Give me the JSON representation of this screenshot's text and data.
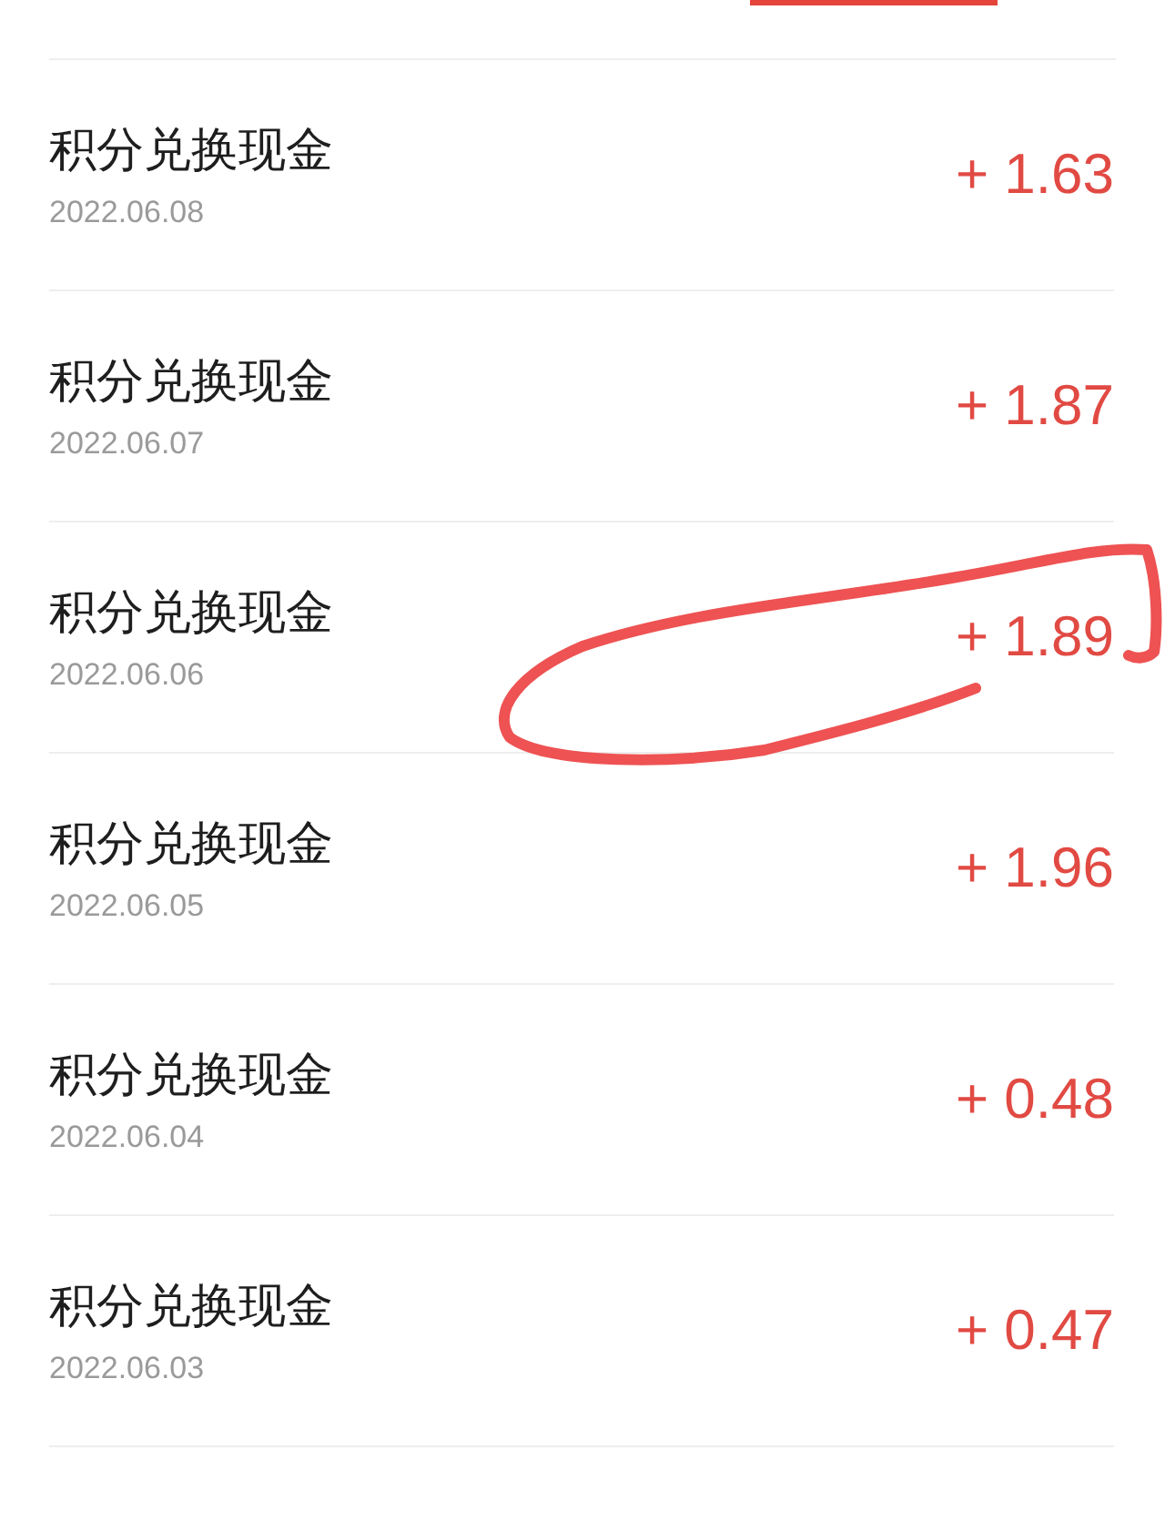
{
  "tabs_indicator": {
    "selected": true
  },
  "records": [
    {
      "title": "积分兑换现金",
      "date": "2022.06.08",
      "amount": "+ 1.63"
    },
    {
      "title": "积分兑换现金",
      "date": "2022.06.07",
      "amount": "+ 1.87"
    },
    {
      "title": "积分兑换现金",
      "date": "2022.06.06",
      "amount": "+ 1.89"
    },
    {
      "title": "积分兑换现金",
      "date": "2022.06.05",
      "amount": "+ 1.96"
    },
    {
      "title": "积分兑换现金",
      "date": "2022.06.04",
      "amount": "+ 0.48"
    },
    {
      "title": "积分兑换现金",
      "date": "2022.06.03",
      "amount": "+ 0.47"
    }
  ]
}
